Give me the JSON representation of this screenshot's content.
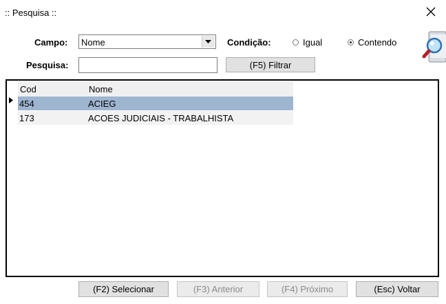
{
  "window": {
    "title": ":: Pesquisa ::"
  },
  "form": {
    "campo_label": "Campo:",
    "campo_value": "Nome",
    "condicao_label": "Condição:",
    "radio_igual": "Igual",
    "radio_contendo": "Contendo",
    "condicao_selected": "Contendo",
    "pesquisa_label": "Pesquisa:",
    "pesquisa_value": "",
    "filter_button": "(F5) Filtrar"
  },
  "grid": {
    "columns": [
      "Cod",
      "Nome"
    ],
    "rows": [
      {
        "cod": "454",
        "nome": "ACIEG"
      },
      {
        "cod": "173",
        "nome": "ACOES JUDICIAIS - TRABALHISTA"
      }
    ],
    "selected_row": 0
  },
  "footer": {
    "select_button": "(F2) Selecionar",
    "prev_button": "(F3) Anterior",
    "next_button": "(F4) Próximo",
    "back_button": "(Esc) Voltar"
  },
  "icons": {
    "close": "close-icon",
    "search_image": "magnifier-icon",
    "dropdown": "chevron-down-icon",
    "row_indicator": "row-pointer-icon"
  }
}
